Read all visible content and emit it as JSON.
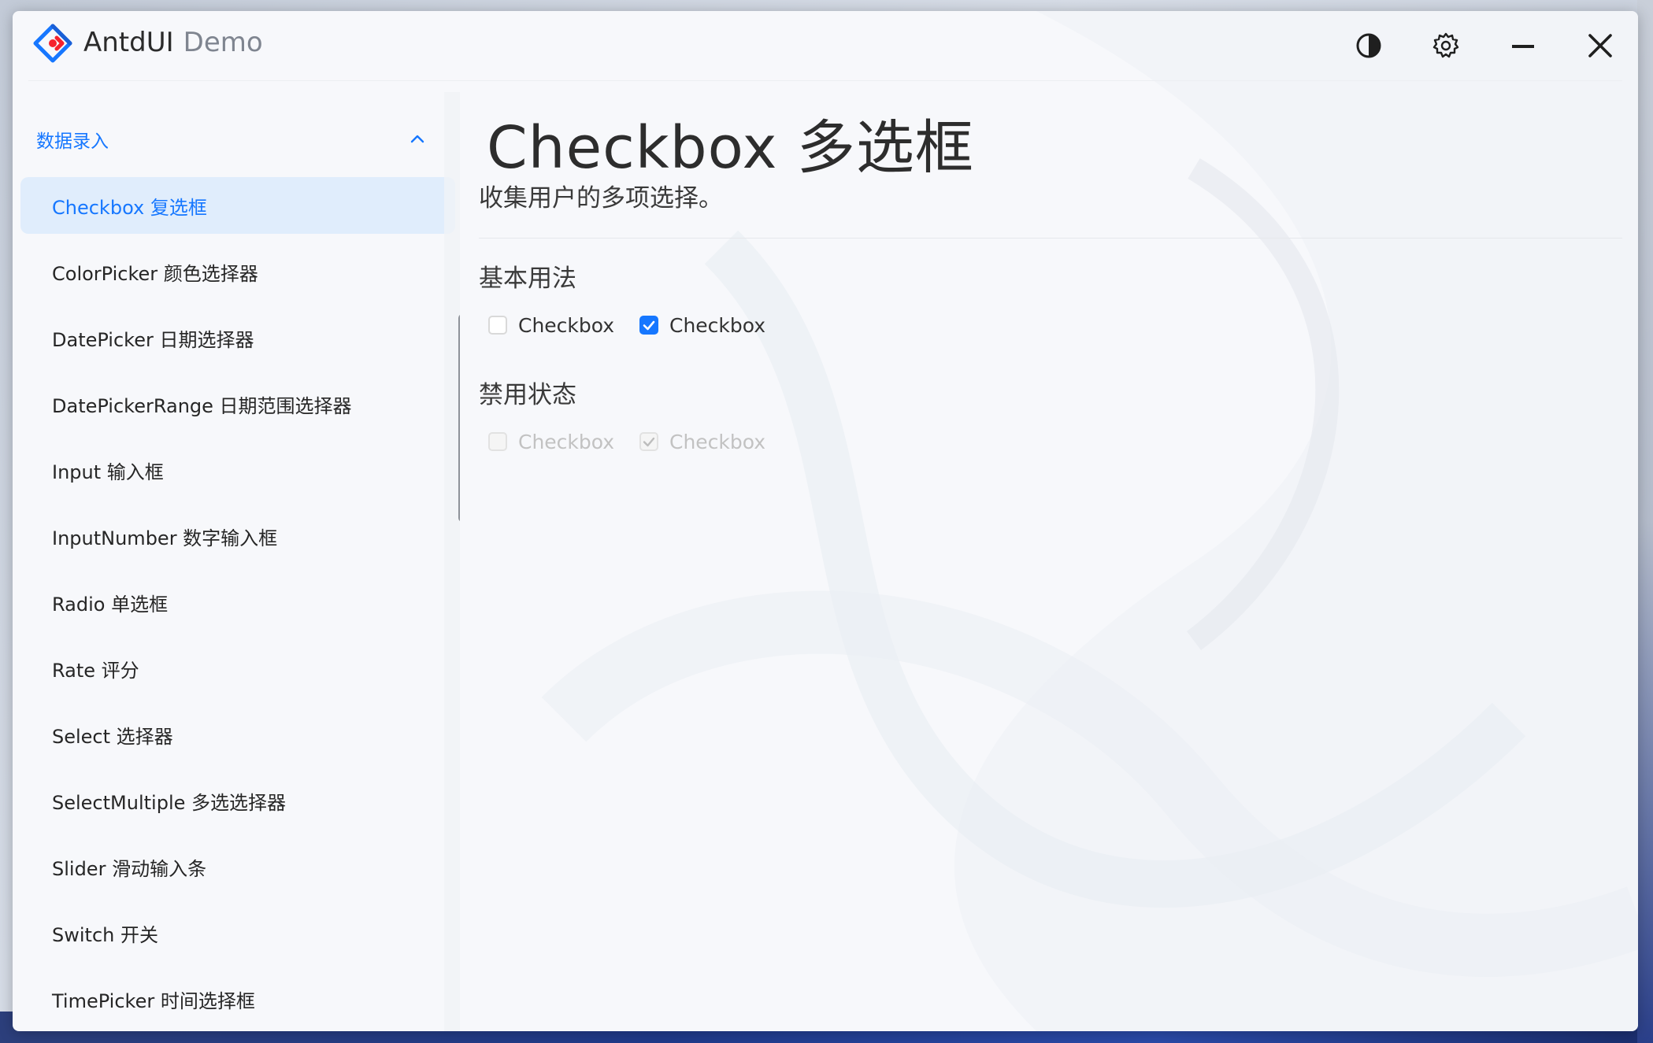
{
  "window": {
    "app_name": "AntdUI",
    "app_suffix": "Demo"
  },
  "titlebar": {
    "buttons": [
      {
        "name": "theme-toggle",
        "icon": "contrast-icon"
      },
      {
        "name": "settings",
        "icon": "gear-icon"
      },
      {
        "name": "minimize",
        "icon": "minimize-icon"
      },
      {
        "name": "close",
        "icon": "close-icon"
      }
    ]
  },
  "sidebar": {
    "group": {
      "label": "数据录入",
      "expanded": true,
      "icon": "chevron-up-icon"
    },
    "items": [
      {
        "label": "Checkbox 复选框",
        "active": true
      },
      {
        "label": "ColorPicker 颜色选择器"
      },
      {
        "label": "DatePicker 日期选择器"
      },
      {
        "label": "DatePickerRange 日期范围选择器"
      },
      {
        "label": "Input 输入框"
      },
      {
        "label": "InputNumber 数字输入框"
      },
      {
        "label": "Radio 单选框"
      },
      {
        "label": "Rate 评分"
      },
      {
        "label": "Select 选择器"
      },
      {
        "label": "SelectMultiple 多选选择器"
      },
      {
        "label": "Slider 滑动输入条"
      },
      {
        "label": "Switch 开关"
      },
      {
        "label": "TimePicker 时间选择框"
      }
    ]
  },
  "main": {
    "title": "Checkbox 多选框",
    "subtitle": "收集用户的多项选择。",
    "sections": [
      {
        "title": "基本用法",
        "checkboxes": [
          {
            "label": "Checkbox",
            "checked": false,
            "disabled": false
          },
          {
            "label": "Checkbox",
            "checked": true,
            "disabled": false
          }
        ]
      },
      {
        "title": "禁用状态",
        "checkboxes": [
          {
            "label": "Checkbox",
            "checked": false,
            "disabled": true
          },
          {
            "label": "Checkbox",
            "checked": true,
            "disabled": true
          }
        ]
      }
    ]
  },
  "colors": {
    "accent": "#1677ff",
    "active_item_bg": "#deecfc",
    "text": "#262626",
    "disabled_text": "#c2c2c2"
  }
}
